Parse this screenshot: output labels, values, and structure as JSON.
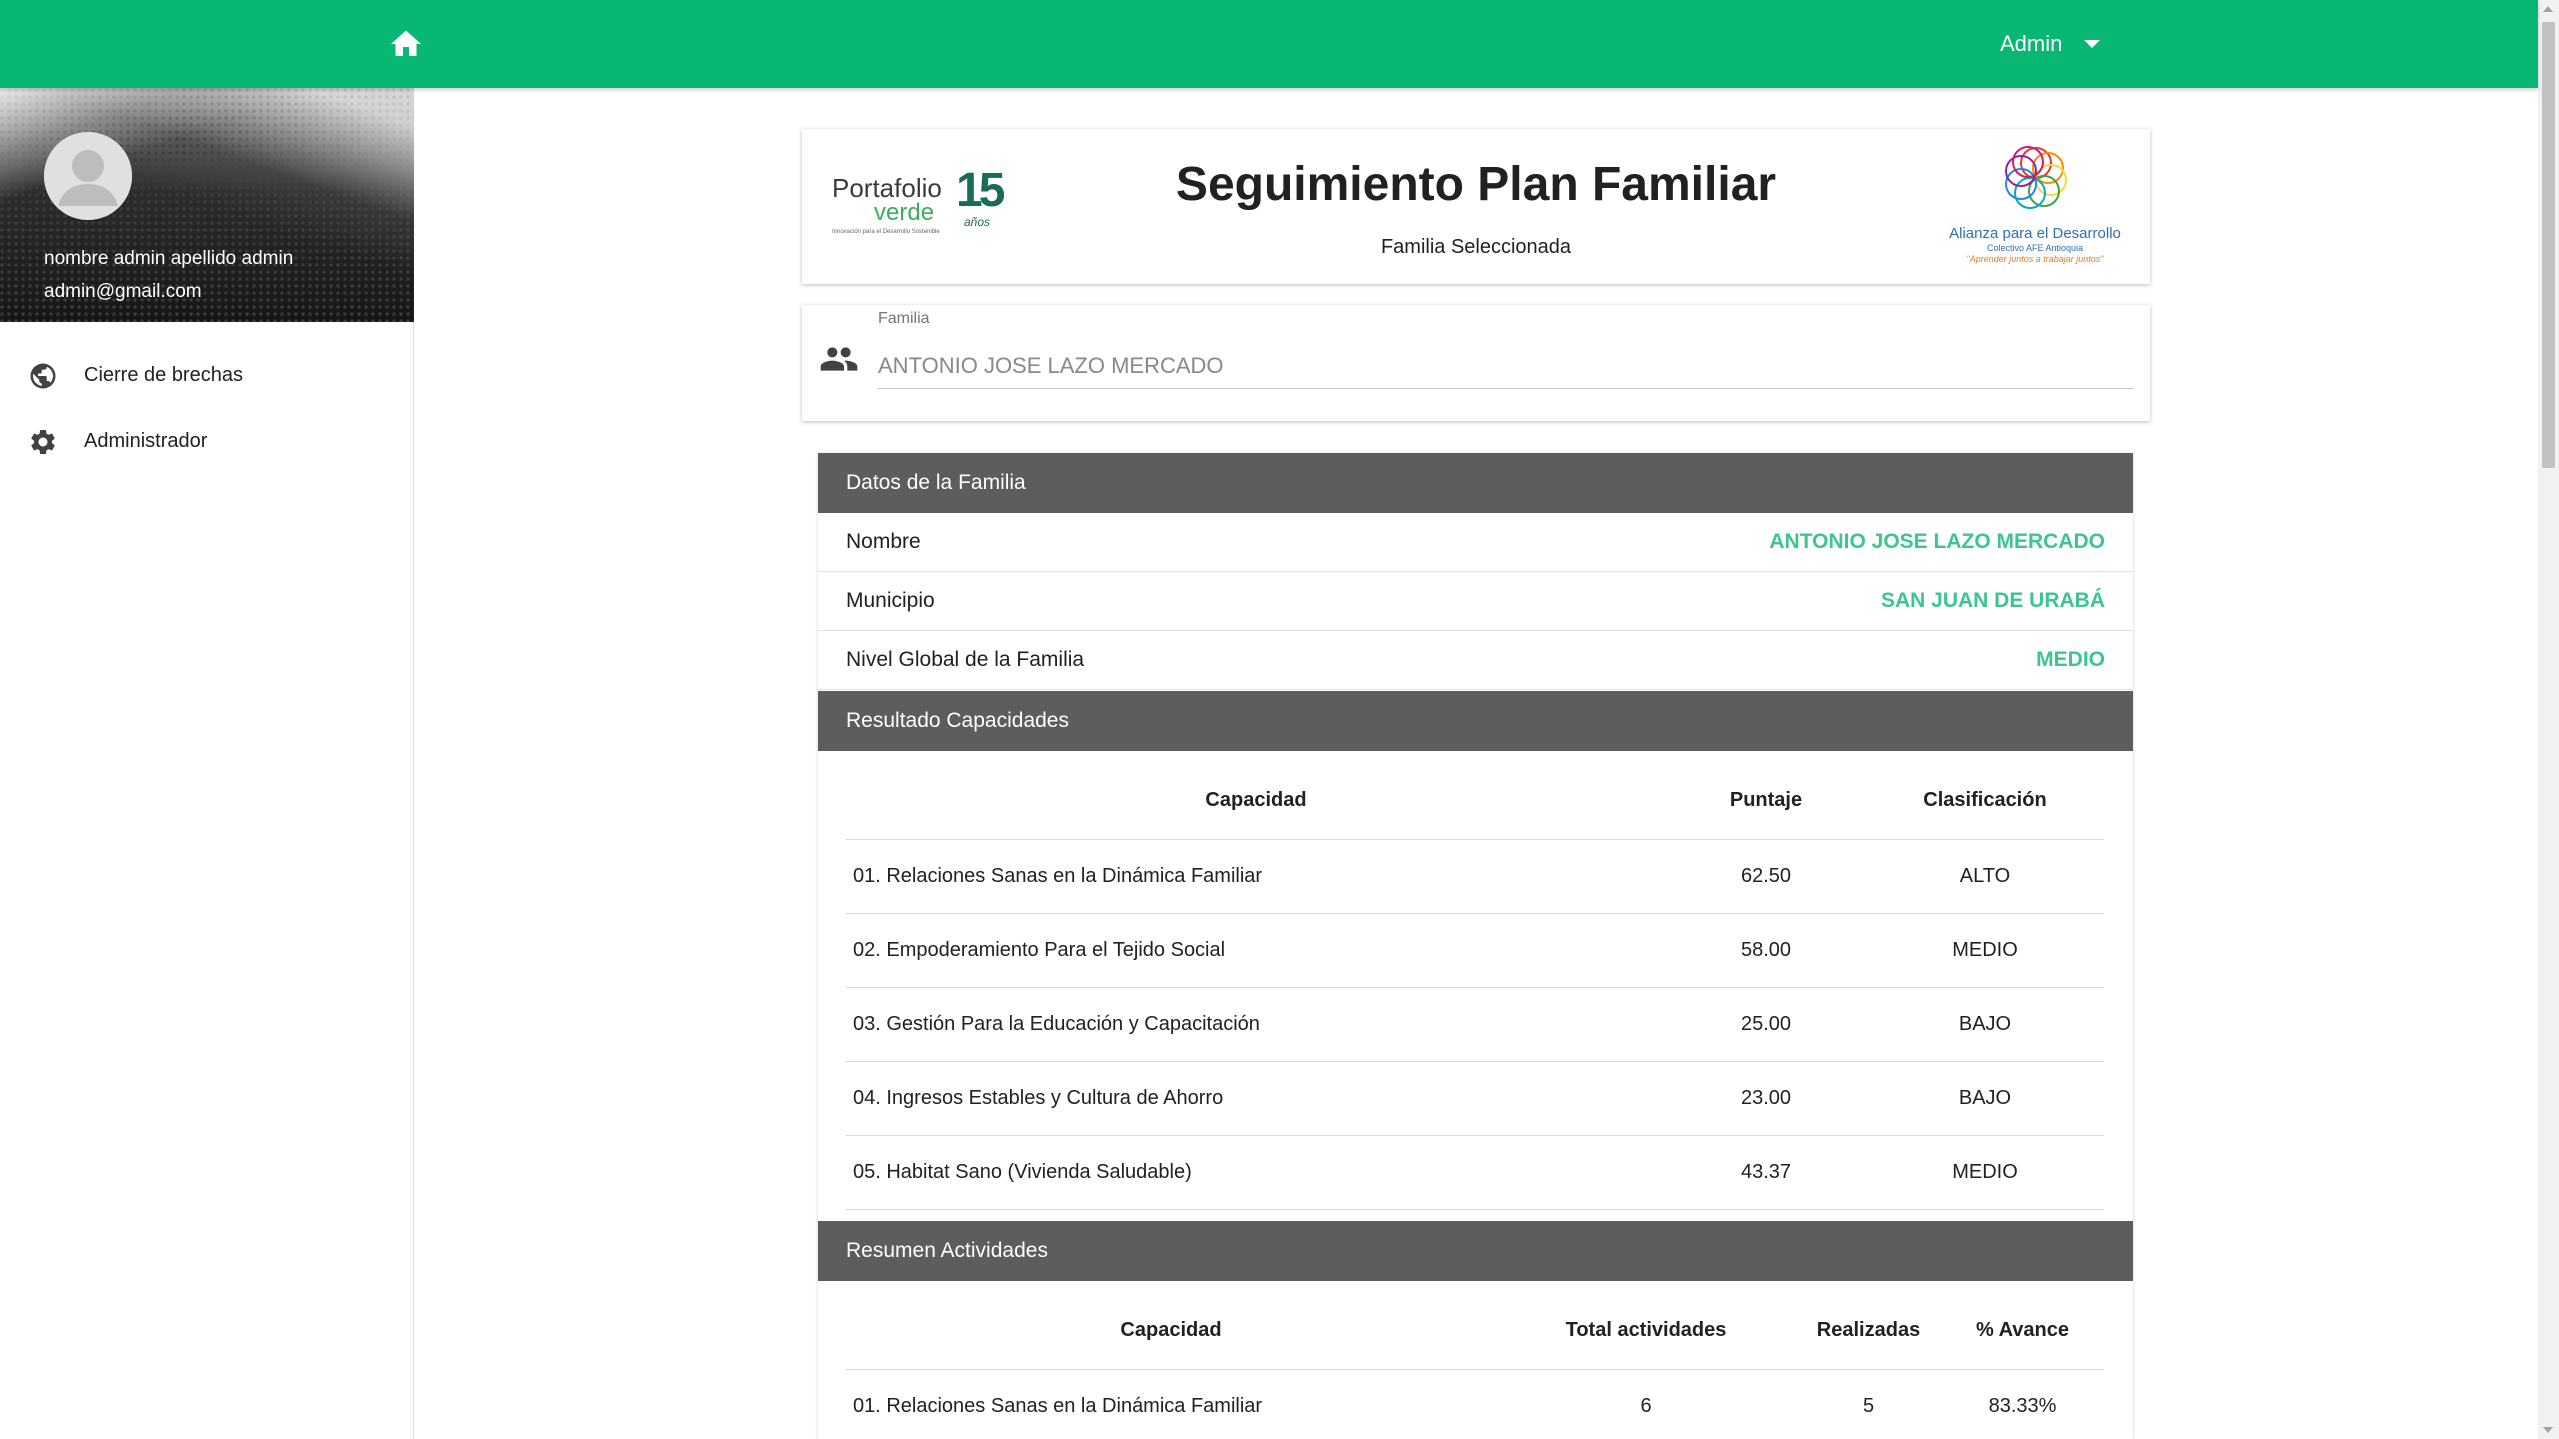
{
  "topbar": {
    "bg_color": "#07b773",
    "home_icon": "home-icon",
    "user_label": "Admin",
    "dropdown_icon": "caret-down-icon"
  },
  "sidebar": {
    "profile": {
      "name": "nombre admin apellido admin",
      "email": "admin@gmail.com",
      "avatar_icon": "person-icon"
    },
    "items": [
      {
        "label": "Cierre de brechas",
        "icon": "globe-icon"
      },
      {
        "label": "Administrador",
        "icon": "gear-icon"
      }
    ]
  },
  "header": {
    "title": "Seguimiento Plan Familiar",
    "subtitle": "Familia Seleccionada",
    "logo_left": {
      "word1": "Portafolio",
      "word2": "verde",
      "tagline": "Innovación para el Desarrollo Sostenible",
      "number": "15",
      "unit": "años"
    },
    "logo_right": {
      "line1": "Alianza para el Desarrollo",
      "line2": "Colectivo AFE Antioquia",
      "line3": "\"Aprender juntos a trabajar juntos\""
    }
  },
  "familia_field": {
    "label": "Familia",
    "value": "ANTONIO JOSE LAZO MERCADO",
    "icon": "people-icon"
  },
  "datos_familia": {
    "heading": "Datos de la Familia",
    "rows": [
      {
        "label": "Nombre",
        "value": "ANTONIO JOSE LAZO MERCADO"
      },
      {
        "label": "Municipio",
        "value": "SAN JUAN DE URABÁ"
      },
      {
        "label": "Nivel Global de la Familia",
        "value": "MEDIO"
      }
    ],
    "value_color": "#3cc58e"
  },
  "resultado_capacidades": {
    "heading": "Resultado Capacidades",
    "columns": [
      "Capacidad",
      "Puntaje",
      "Clasificación"
    ],
    "rows": [
      {
        "capacidad": "01. Relaciones Sanas en la Dinámica Familiar",
        "puntaje": "62.50",
        "clasificacion": "ALTO"
      },
      {
        "capacidad": "02. Empoderamiento Para el Tejido Social",
        "puntaje": "58.00",
        "clasificacion": "MEDIO"
      },
      {
        "capacidad": "03. Gestión Para la Educación y Capacitación",
        "puntaje": "25.00",
        "clasificacion": "BAJO"
      },
      {
        "capacidad": "04. Ingresos Estables y Cultura de Ahorro",
        "puntaje": "23.00",
        "clasificacion": "BAJO"
      },
      {
        "capacidad": "05. Habitat Sano (Vivienda Saludable)",
        "puntaje": "43.37",
        "clasificacion": "MEDIO"
      }
    ]
  },
  "resumen_actividades": {
    "heading": "Resumen Actividades",
    "columns": [
      "Capacidad",
      "Total actividades",
      "Realizadas",
      "% Avance"
    ],
    "rows": [
      {
        "capacidad": "01. Relaciones Sanas en la Dinámica Familiar",
        "total": "6",
        "realizadas": "5",
        "avance": "83.33%"
      }
    ]
  },
  "section_color": "#5d5d5d"
}
